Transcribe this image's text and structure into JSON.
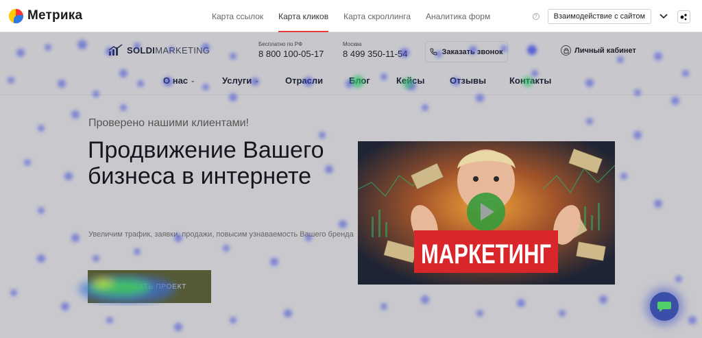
{
  "metrika": {
    "logo_text": "Метрика",
    "tabs": [
      {
        "label": "Карта ссылок",
        "active": false
      },
      {
        "label": "Карта кликов",
        "active": true
      },
      {
        "label": "Карта скроллинга",
        "active": false
      },
      {
        "label": "Аналитика форм",
        "active": false
      }
    ],
    "interaction_select": "Взаимодействие с сайтом",
    "accent": "#e8393b"
  },
  "site": {
    "brand": "SOLDI",
    "brand_suffix": "MARKETING",
    "phones": [
      {
        "label": "Бесплатно по РФ",
        "number": "8 800 100-05-17"
      },
      {
        "label": "Москва",
        "number": "8 499 350-11-54"
      }
    ],
    "callback_label": "Заказать звонок",
    "cabinet_label": "Личный кабинет",
    "nav": [
      {
        "label": "О нас",
        "has_dropdown": true
      },
      {
        "label": "Услуги",
        "has_dropdown": true
      },
      {
        "label": "Отрасли",
        "has_dropdown": false
      },
      {
        "label": "Блог",
        "has_dropdown": false
      },
      {
        "label": "Кейсы",
        "has_dropdown": false
      },
      {
        "label": "Отзывы",
        "has_dropdown": false
      },
      {
        "label": "Контакты",
        "has_dropdown": false
      }
    ]
  },
  "hero": {
    "eyebrow": "Проверено нашими клиентами!",
    "title": "Продвижение Вашего бизнеса в интернете",
    "subtitle": "Увеличим трафик, заявки, продажи, повысим узнаваемость Вашего бренда",
    "cta": "Обсудить проект",
    "video_caption": "МАРКЕТИНГ"
  }
}
